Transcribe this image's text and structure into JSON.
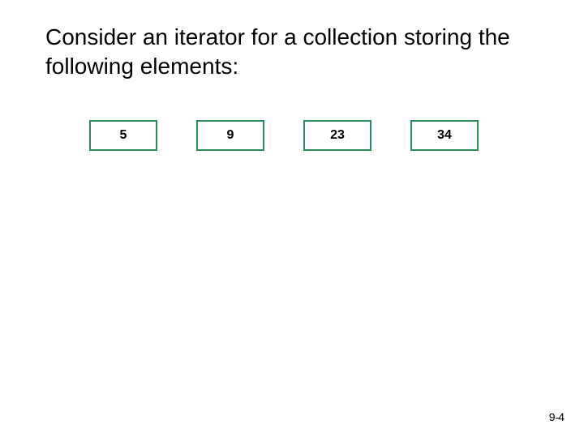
{
  "heading": "Consider an iterator for a collection storing the following elements:",
  "elements": [
    "5",
    "9",
    "23",
    "34"
  ],
  "pagination": {
    "chapter": "9",
    "sep": "-",
    "page": "4"
  },
  "colors": {
    "box_border": "#2f8a5b"
  }
}
